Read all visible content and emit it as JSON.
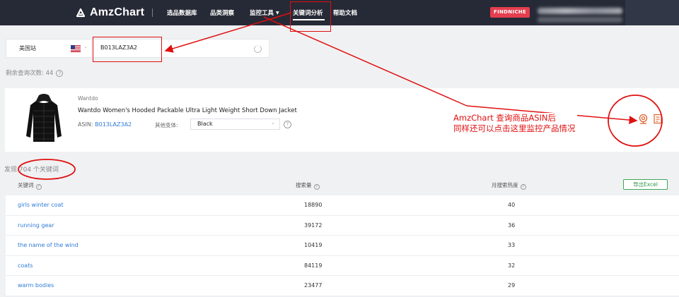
{
  "nav": {
    "logo_text": "AmzChart",
    "items": [
      {
        "label": "选品数据库"
      },
      {
        "label": "品类洞察"
      },
      {
        "label": "监控工具"
      },
      {
        "label": "关键词分析"
      },
      {
        "label": "帮助文档"
      }
    ],
    "active_index": 3,
    "findniche_label": "FINDNICHE"
  },
  "search": {
    "site_label": "美国站",
    "asin_value": "B013LAZ3A2"
  },
  "remaining_queries": "剩余查询次数: 44",
  "product": {
    "brand": "Wantdo",
    "title": "Wantdo Women's Hooded Packable Ultra Light Weight Short Down Jacket",
    "asin_label": "ASIN:",
    "asin": "B013LAZ3A2",
    "variant_label": "其他变体:",
    "variant_value": "Black"
  },
  "found_text": "发现 704 个关键词",
  "table": {
    "headers": {
      "keyword": "关键词",
      "volume": "搜索量",
      "heat": "月搜索热度"
    },
    "export_label": "导出Excel",
    "rows": [
      {
        "keyword": "girls winter coat",
        "volume": "18890",
        "heat": "40"
      },
      {
        "keyword": "running gear",
        "volume": "39172",
        "heat": "36"
      },
      {
        "keyword": "the name of the wind",
        "volume": "10419",
        "heat": "33"
      },
      {
        "keyword": "coats",
        "volume": "84119",
        "heat": "32"
      },
      {
        "keyword": "warm bodies",
        "volume": "23477",
        "heat": "29"
      }
    ]
  },
  "annotation": {
    "line1": "AmzChart 查询商品ASIN后",
    "line2": "同样还可以点击这里监控产品情况",
    "color": "#e01010"
  },
  "colors": {
    "nav_bg": "#262a36",
    "accent_link": "#2f7bd6",
    "findniche_bg": "#e53e4f",
    "export_green": "#2f9548"
  }
}
